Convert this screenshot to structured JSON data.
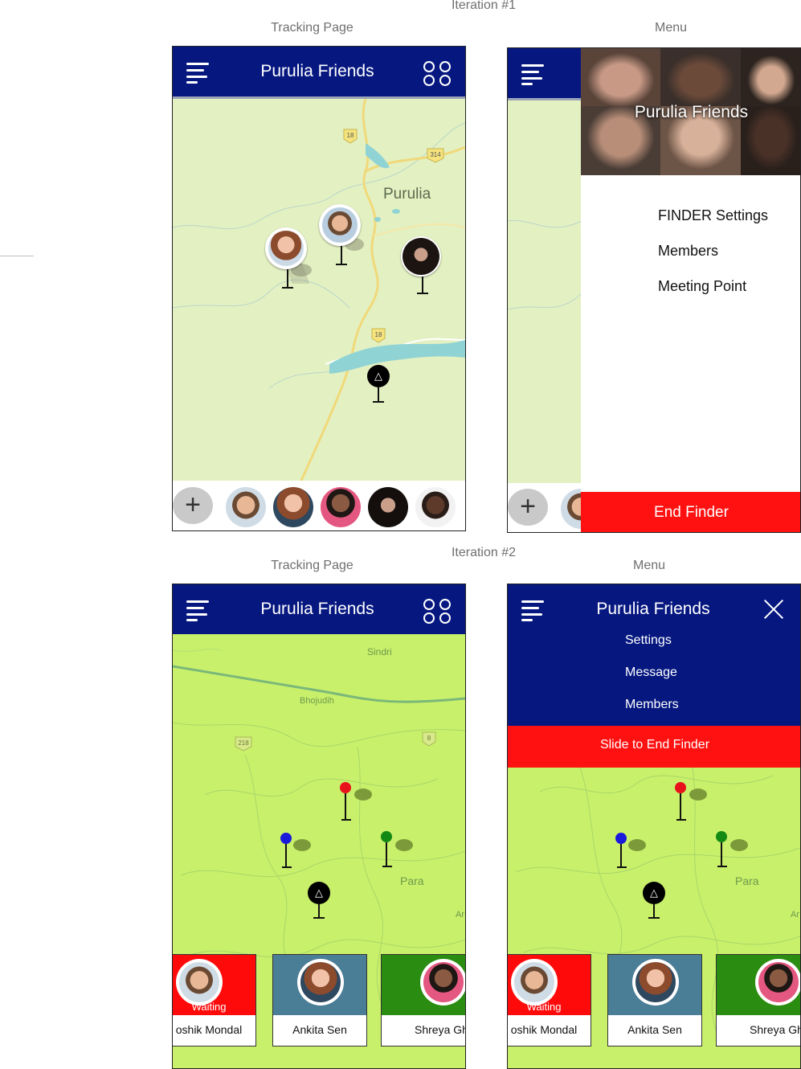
{
  "iteration1": {
    "label": "Iteration #1",
    "tracking": {
      "caption": "Tracking Page",
      "title": "Purulia Friends",
      "map": {
        "city": "Purulia",
        "road_badges": [
          "18",
          "314",
          "18"
        ]
      },
      "add_button": "+"
    },
    "menu": {
      "caption": "Menu",
      "title": "Purulia Friends",
      "items": [
        "FINDER Settings",
        "Members",
        "Meeting Point"
      ],
      "end_button": "End Finder"
    }
  },
  "iteration2": {
    "label": "Iteration #2",
    "tracking": {
      "caption": "Tracking Page",
      "title": "Purulia Friends",
      "map": {
        "places": [
          "Sindri",
          "Bhojudih",
          "Para",
          "Ar"
        ],
        "road_badges": [
          "218",
          "8"
        ]
      },
      "members": [
        {
          "name": "oshik Mondal",
          "status": "Waiting",
          "color": "#ff0a0a"
        },
        {
          "name": "Ankita Sen",
          "status": "",
          "color": "#4a7e96"
        },
        {
          "name": "Shreya Gh",
          "status": "",
          "color": "#2a8c10"
        }
      ]
    },
    "menu": {
      "caption": "Menu",
      "title": "Purulia Friends",
      "items": [
        "Settings",
        "Message",
        "Members"
      ],
      "slide_button": "Slide to End Finder"
    }
  },
  "colors": {
    "appbar": "#061880",
    "danger": "#ff1111",
    "map_iteration1": "#e3f0c2",
    "map_iteration2": "#c9f06a",
    "pin_red": "#e8121b",
    "pin_blue": "#1a1adb",
    "pin_green": "#138a13"
  }
}
